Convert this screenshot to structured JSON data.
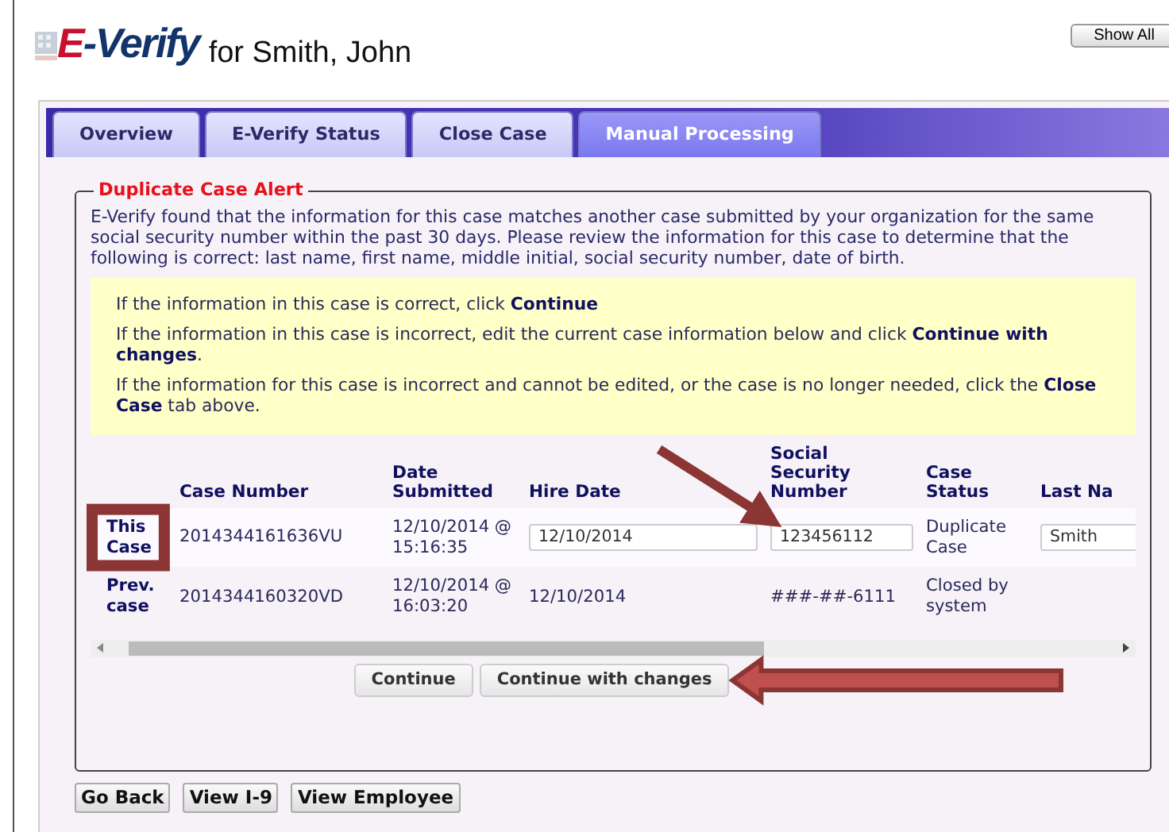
{
  "header": {
    "logo_text": "E-Verify",
    "title": "for Smith, John",
    "show_all_button": "Show All"
  },
  "tabs": [
    {
      "label": "Overview",
      "selected": false
    },
    {
      "label": "E-Verify Status",
      "selected": false
    },
    {
      "label": "Close Case",
      "selected": false
    },
    {
      "label": "Manual Processing",
      "selected": true
    }
  ],
  "alert": {
    "legend": "Duplicate Case Alert",
    "message": "E-Verify found that the information for this case matches another case submitted by your organization for the same social security number within the past 30 days. Please review the information for this case to determine that the following is correct: last name, first name, middle initial, social security number, date of birth.",
    "instructions": [
      "If the information in this case is correct, click **Continue**",
      "If the information in this case is incorrect, edit the current case information below and click **Continue with changes**.",
      "If the information for this case is incorrect and cannot be edited, or the case is no longer needed, click the **Close Case** tab above."
    ]
  },
  "table": {
    "columns": [
      "Case Number",
      "Date Submitted",
      "Hire Date",
      "Social Security Number",
      "Case Status",
      "Last Na"
    ],
    "rows": [
      {
        "label": "This Case",
        "cells": [
          {
            "kind": "text",
            "text": "2014344161636VU"
          },
          {
            "kind": "text",
            "text": "12/10/2014 @ 15:16:35"
          },
          {
            "kind": "input",
            "value": "12/10/2014"
          },
          {
            "kind": "input",
            "value": "123456112"
          },
          {
            "kind": "text",
            "text": "Duplicate Case"
          },
          {
            "kind": "input",
            "value": "Smith"
          }
        ]
      },
      {
        "label": "Prev. case",
        "cells": [
          {
            "kind": "text",
            "text": "2014344160320VD"
          },
          {
            "kind": "text",
            "text": "12/10/2014 @ 16:03:20"
          },
          {
            "kind": "text",
            "text": "12/10/2014"
          },
          {
            "kind": "text",
            "text": "###-##-6111"
          },
          {
            "kind": "text",
            "text": "Closed by system"
          }
        ]
      }
    ]
  },
  "actions": [
    "Continue",
    "Continue with changes"
  ],
  "footer_buttons": [
    "Go Back",
    "View I-9",
    "View Employee"
  ]
}
